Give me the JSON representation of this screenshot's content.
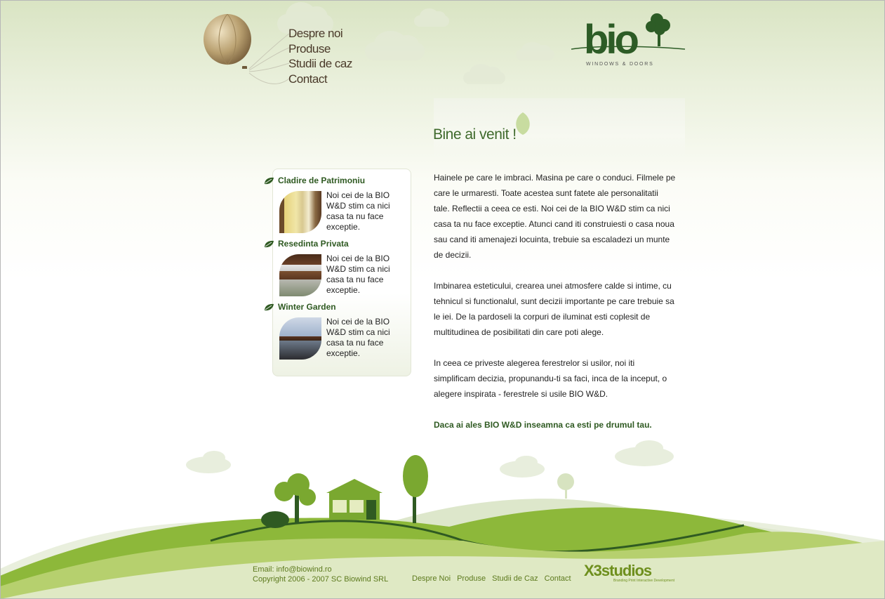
{
  "nav": {
    "items": [
      {
        "label": "Despre noi"
      },
      {
        "label": "Produse"
      },
      {
        "label": "Studii de caz"
      },
      {
        "label": "Contact"
      }
    ]
  },
  "logo": {
    "word": "bio",
    "subtitle": "WINDOWS & DOORS"
  },
  "welcome": {
    "title": "Bine ai venit !",
    "paragraphs": [
      "Hainele pe care le imbraci. Masina pe care o conduci. Filmele pe care le urmaresti. Toate acestea sunt fatete ale personalitatii tale. Reflectii a ceea ce esti. Noi cei de la BIO W&D stim ca nici casa ta nu face exceptie. Atunci cand iti construiesti o casa noua sau cand iti amenajezi locuinta, trebuie sa escaladezi un munte de decizii.",
      "Imbinarea esteticului, crearea unei atmosfere calde si intime, cu tehnicul si functionalul, sunt decizii importante pe care trebuie sa le iei. De la pardoseli la corpuri de iluminat esti coplesit de multitudinea de posibilitati din care poti alege.",
      "In ceea ce priveste alegerea ferestrelor si usilor, noi iti simplificam decizia, propunandu-ti sa faci, inca de la inceput, o alegere inspirata - ferestrele si usile BIO W&D."
    ],
    "motto": "Daca ai ales BIO W&D inseamna ca esti pe drumul tau."
  },
  "sidebar": {
    "items": [
      {
        "title": "Cladire de Patrimoniu",
        "desc": "Noi cei de la BIO W&D stim ca nici casa ta nu face exceptie."
      },
      {
        "title": "Resedinta Privata",
        "desc": "Noi cei de la BIO W&D stim ca nici casa ta nu face exceptie."
      },
      {
        "title": "Winter Garden",
        "desc": "Noi cei de la BIO W&D stim ca nici casa ta nu face exceptie."
      }
    ]
  },
  "footer": {
    "email": "Email:  info@biowind.ro",
    "copyright": "Copyright 2006 - 2007 SC Biowind SRL",
    "nav": [
      "Despre Noi",
      "Produse",
      "Studii de Caz",
      "Contact"
    ],
    "credit_big": "X3studios",
    "credit_small": "Branding Print Interactive Development"
  },
  "colors": {
    "brand_green": "#2d5c26",
    "hill_green": "#8db83a",
    "footer_text": "#5d7a1e",
    "nav_text": "#4a3a2a"
  }
}
